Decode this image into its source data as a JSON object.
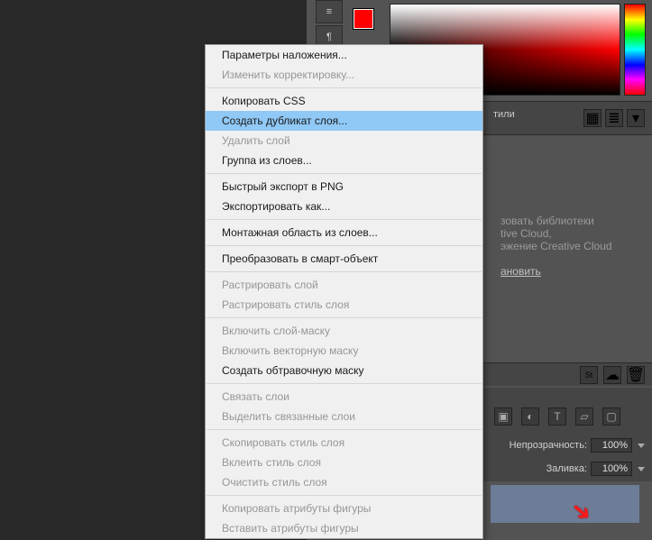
{
  "context_menu": {
    "items": [
      {
        "label": "Параметры наложения...",
        "state": "enabled"
      },
      {
        "label": "Изменить корректировку...",
        "state": "disabled"
      },
      {
        "sep": true
      },
      {
        "label": "Копировать CSS",
        "state": "enabled"
      },
      {
        "label": "Создать дубликат слоя...",
        "state": "highlight"
      },
      {
        "label": "Удалить слой",
        "state": "disabled"
      },
      {
        "label": "Группа из слоев...",
        "state": "enabled"
      },
      {
        "sep": true
      },
      {
        "label": "Быстрый экспорт в PNG",
        "state": "enabled"
      },
      {
        "label": "Экспортировать как...",
        "state": "enabled"
      },
      {
        "sep": true
      },
      {
        "label": "Монтажная область из слоев...",
        "state": "enabled"
      },
      {
        "sep": true
      },
      {
        "label": "Преобразовать в смарт-объект",
        "state": "enabled"
      },
      {
        "sep": true
      },
      {
        "label": "Растрировать слой",
        "state": "disabled"
      },
      {
        "label": "Растрировать стиль слоя",
        "state": "disabled"
      },
      {
        "sep": true
      },
      {
        "label": "Включить слой-маску",
        "state": "disabled"
      },
      {
        "label": "Включить векторную маску",
        "state": "disabled"
      },
      {
        "label": "Создать обтравочную маску",
        "state": "enabled"
      },
      {
        "sep": true
      },
      {
        "label": "Связать слои",
        "state": "disabled"
      },
      {
        "label": "Выделить связанные слои",
        "state": "disabled"
      },
      {
        "sep": true
      },
      {
        "label": "Скопировать стиль слоя",
        "state": "disabled"
      },
      {
        "label": "Вклеить стиль слоя",
        "state": "disabled"
      },
      {
        "label": "Очистить стиль слоя",
        "state": "disabled"
      },
      {
        "sep": true
      },
      {
        "label": "Копировать атрибуты фигуры",
        "state": "disabled"
      },
      {
        "label": "Вставить атрибуты фигуры",
        "state": "disabled"
      }
    ]
  },
  "panels": {
    "styles_tab": "тили",
    "cc_promo": {
      "line1": "зовать библиотеки",
      "line2": "tive Cloud,",
      "line3": "эжение Creative Cloud",
      "link": "ановить"
    },
    "opacity_label": "Непрозрачность:",
    "opacity_value": "100%",
    "fill_label": "Заливка:",
    "fill_value": "100%",
    "layer_color": "#6d7d98"
  }
}
